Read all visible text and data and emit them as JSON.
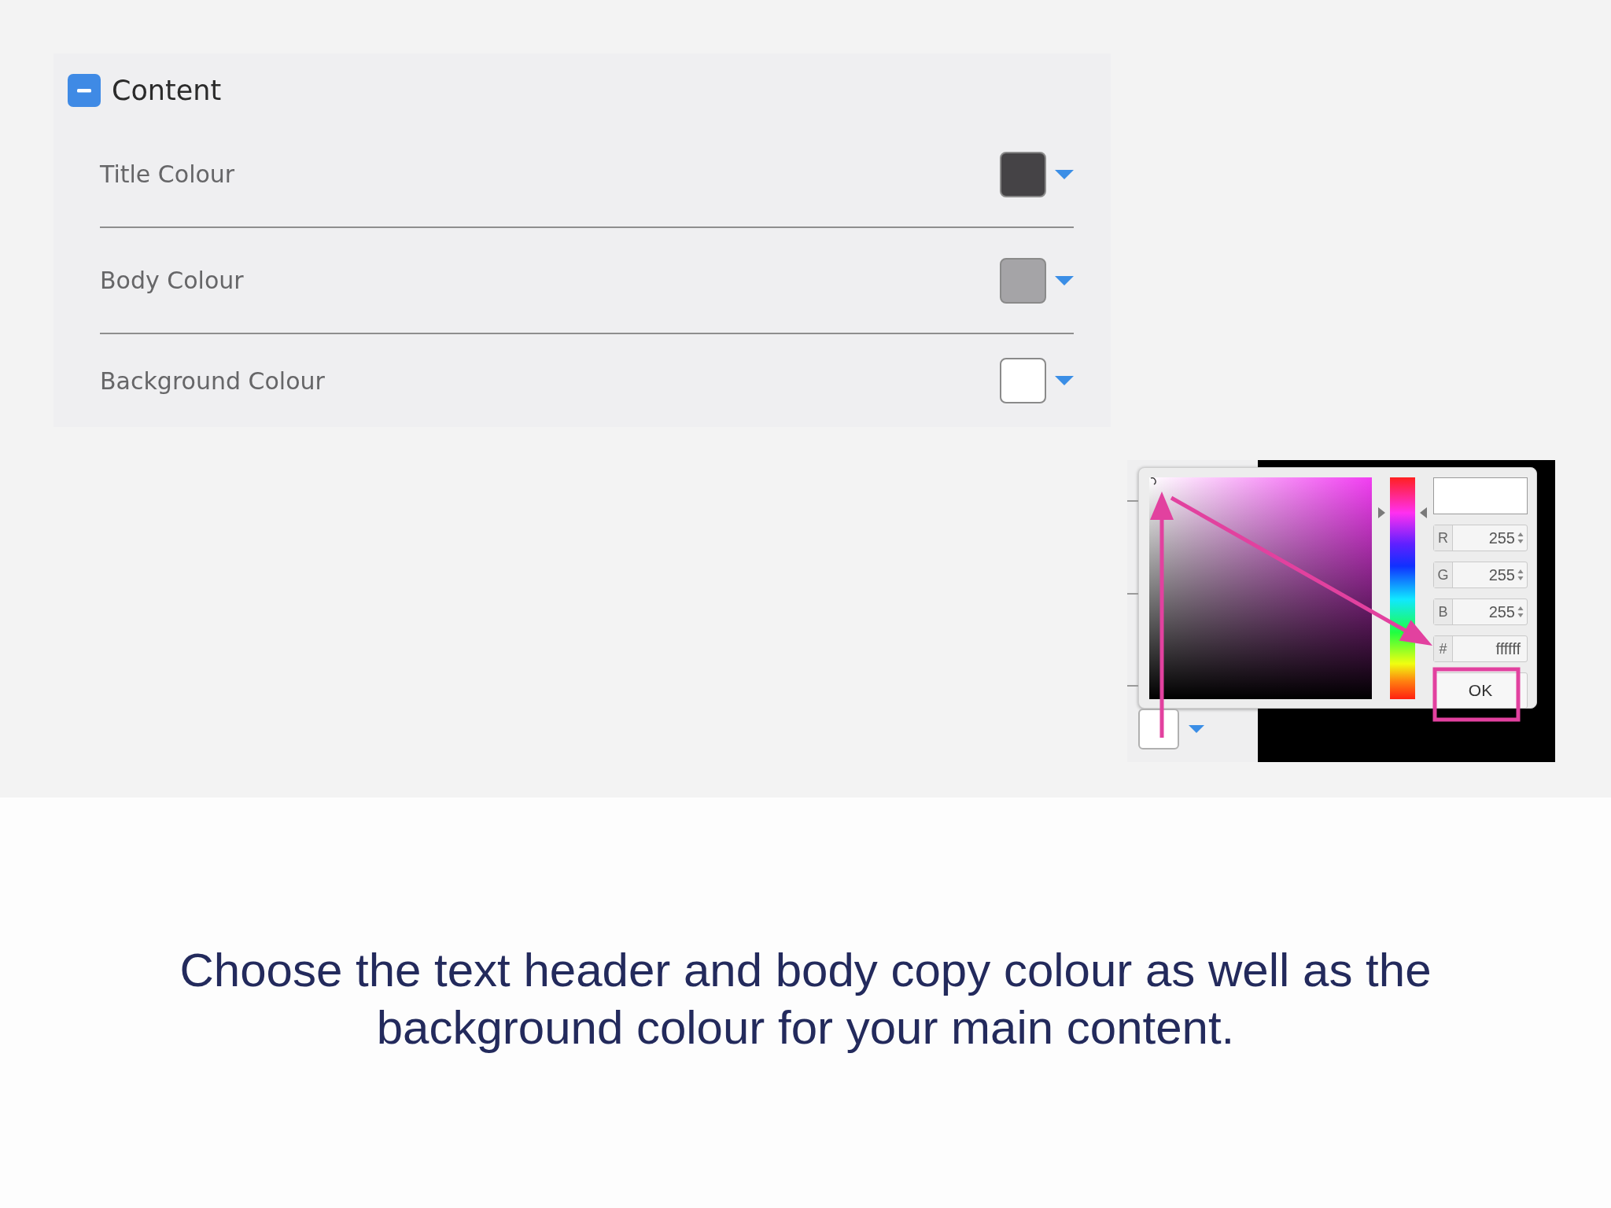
{
  "panel": {
    "title": "Content",
    "expanded": true,
    "rows": [
      {
        "label": "Title Colour",
        "color": "#454346"
      },
      {
        "label": "Body Colour",
        "color": "#a5a4a7"
      },
      {
        "label": "Background Colour",
        "color": "#ffffff"
      }
    ]
  },
  "picker_screenshot": {
    "hue_slider": {
      "level": 0.84
    },
    "fields": [
      {
        "kind": "spin",
        "label": "R",
        "value": "255"
      },
      {
        "kind": "spin",
        "label": "G",
        "value": "255"
      },
      {
        "kind": "spin",
        "label": "B",
        "value": "255"
      },
      {
        "kind": "text",
        "label": "#",
        "value": "ffffff"
      }
    ],
    "button_label": "OK"
  },
  "caption": "Choose the text header and body copy colour as well as the background colour for your main content."
}
